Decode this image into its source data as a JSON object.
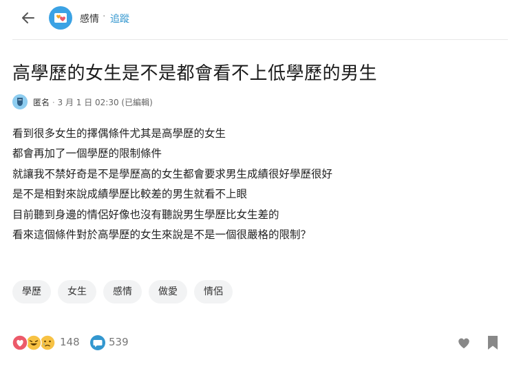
{
  "header": {
    "board_name": "感情",
    "separator": "·",
    "follow_label": "追蹤"
  },
  "post": {
    "title": "高學歷的女生是不是都會看不上低學歷的男生",
    "author": "匿名",
    "separator": "·",
    "timestamp": "3 月 1 日 02:30 (已編輯)",
    "body_lines": [
      "看到很多女生的擇偶條件尤其是高學歷的女生",
      "都會再加了一個學歷的限制條件",
      "就讓我不禁好奇是不是學歷高的女生都會要求男生成績很好學歷很好",
      "是不是相對來說成績學歷比較差的男生就看不上眼",
      "目前聽到身邊的情侶好像也沒有聽說男生學歷比女生差的",
      "看來這個條件對於高學歷的女生來說是不是一個很嚴格的限制？"
    ],
    "tags": [
      "學歷",
      "女生",
      "感情",
      "做愛",
      "情侶"
    ]
  },
  "footer": {
    "reaction_count": "148",
    "comment_count": "539",
    "reaction_icons": [
      "heart-reaction-icon",
      "haha-reaction-icon",
      "cry-reaction-icon"
    ]
  },
  "colors": {
    "accent": "#3397cf",
    "board_icon": "#3ba2e4",
    "heart_red": "#ec5a6a",
    "reaction_yellow": "#f7c244",
    "icon_gray": "#777777",
    "tag_bg": "#f2f3f4"
  }
}
